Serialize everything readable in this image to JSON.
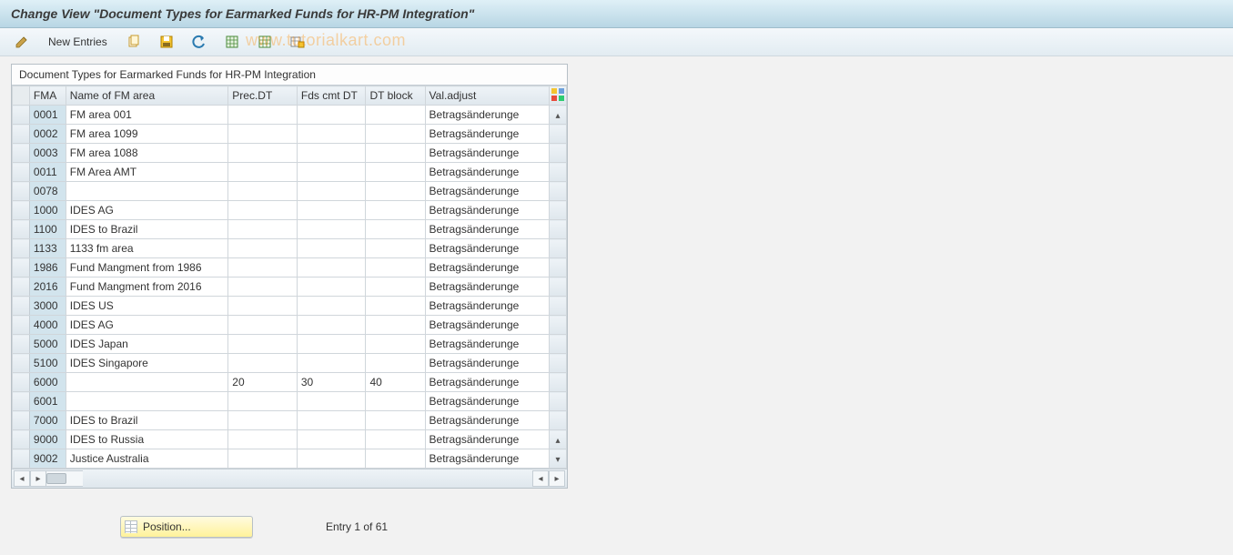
{
  "title": "Change View \"Document Types for Earmarked Funds for HR-PM Integration\"",
  "toolbar": {
    "new_entries": "New Entries"
  },
  "watermark": "www.tutorialkart.com",
  "table": {
    "caption": "Document Types for Earmarked Funds for HR-PM Integration",
    "headers": {
      "fma": "FMA",
      "name": "Name of FM area",
      "prec": "Prec.DT",
      "fds": "Fds cmt DT",
      "dtblock": "DT block",
      "valadjust": "Val.adjust"
    },
    "rows": [
      {
        "fma": "0001",
        "name": "FM area 001",
        "prec": "",
        "fds": "",
        "dtb": "",
        "val": "Betragsänderunge"
      },
      {
        "fma": "0002",
        "name": "FM area 1099",
        "prec": "",
        "fds": "",
        "dtb": "",
        "val": "Betragsänderunge"
      },
      {
        "fma": "0003",
        "name": "FM area 1088",
        "prec": "",
        "fds": "",
        "dtb": "",
        "val": "Betragsänderunge"
      },
      {
        "fma": "0011",
        "name": "FM Area AMT",
        "prec": "",
        "fds": "",
        "dtb": "",
        "val": "Betragsänderunge"
      },
      {
        "fma": "0078",
        "name": "",
        "prec": "",
        "fds": "",
        "dtb": "",
        "val": "Betragsänderunge"
      },
      {
        "fma": "1000",
        "name": "IDES AG",
        "prec": "",
        "fds": "",
        "dtb": "",
        "val": "Betragsänderunge"
      },
      {
        "fma": "1100",
        "name": "IDES to Brazil",
        "prec": "",
        "fds": "",
        "dtb": "",
        "val": "Betragsänderunge"
      },
      {
        "fma": "1133",
        "name": "1133 fm area",
        "prec": "",
        "fds": "",
        "dtb": "",
        "val": "Betragsänderunge"
      },
      {
        "fma": "1986",
        "name": "Fund Mangment from 1986",
        "prec": "",
        "fds": "",
        "dtb": "",
        "val": "Betragsänderunge"
      },
      {
        "fma": "2016",
        "name": "Fund Mangment from 2016",
        "prec": "",
        "fds": "",
        "dtb": "",
        "val": "Betragsänderunge"
      },
      {
        "fma": "3000",
        "name": "IDES US",
        "prec": "",
        "fds": "",
        "dtb": "",
        "val": "Betragsänderunge"
      },
      {
        "fma": "4000",
        "name": "IDES AG",
        "prec": "",
        "fds": "",
        "dtb": "",
        "val": "Betragsänderunge"
      },
      {
        "fma": "5000",
        "name": "IDES Japan",
        "prec": "",
        "fds": "",
        "dtb": "",
        "val": "Betragsänderunge"
      },
      {
        "fma": "5100",
        "name": "IDES Singapore",
        "prec": "",
        "fds": "",
        "dtb": "",
        "val": "Betragsänderunge"
      },
      {
        "fma": "6000",
        "name": "",
        "prec": "20",
        "fds": "30",
        "dtb": "40",
        "val": "Betragsänderunge"
      },
      {
        "fma": "6001",
        "name": "",
        "prec": "",
        "fds": "",
        "dtb": "",
        "val": "Betragsänderunge"
      },
      {
        "fma": "7000",
        "name": "IDES to Brazil",
        "prec": "",
        "fds": "",
        "dtb": "",
        "val": "Betragsänderunge"
      },
      {
        "fma": "9000",
        "name": "IDES to Russia",
        "prec": "",
        "fds": "",
        "dtb": "",
        "val": "Betragsänderunge"
      },
      {
        "fma": "9002",
        "name": "Justice Australia",
        "prec": "",
        "fds": "",
        "dtb": "",
        "val": "Betragsänderunge"
      }
    ]
  },
  "footer": {
    "position_btn": "Position...",
    "entry_status": "Entry 1 of 61"
  }
}
